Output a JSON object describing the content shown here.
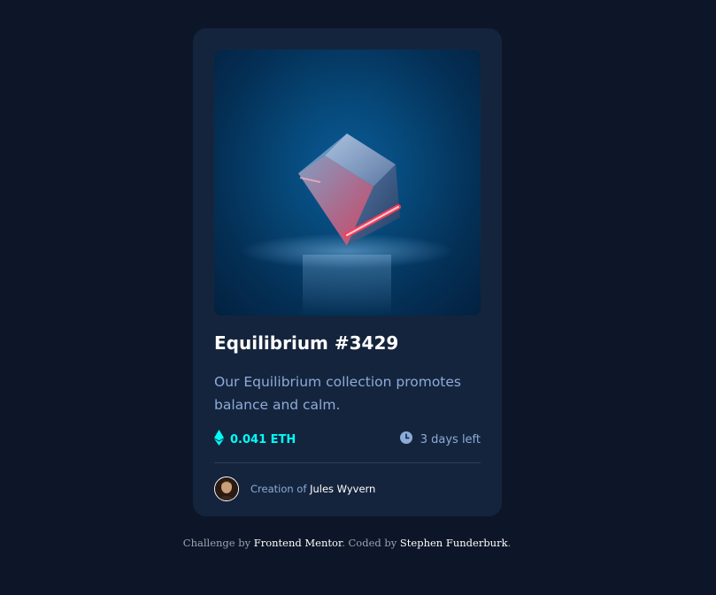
{
  "card": {
    "title": "Equilibrium #3429",
    "description": "Our Equilibrium collection promotes balance and calm.",
    "price": "0.041 ETH",
    "time_left": "3 days left",
    "creator_prefix": "Creation of",
    "creator_name": "Jules Wyvern"
  },
  "footer": {
    "challenge_prefix": "Challenge by ",
    "challenge_link": "Frontend Mentor",
    "coded_prefix": ". Coded by ",
    "coded_link": "Stephen Funderburk",
    "suffix": "."
  },
  "icons": {
    "price": "ethereum-icon",
    "time": "clock-icon"
  },
  "colors": {
    "page_bg": "#0d1628",
    "card_bg": "#15243d",
    "accent_cyan": "#00fff8",
    "soft_blue": "#8bacd9",
    "divider": "#2e405a",
    "white": "#ffffff"
  }
}
